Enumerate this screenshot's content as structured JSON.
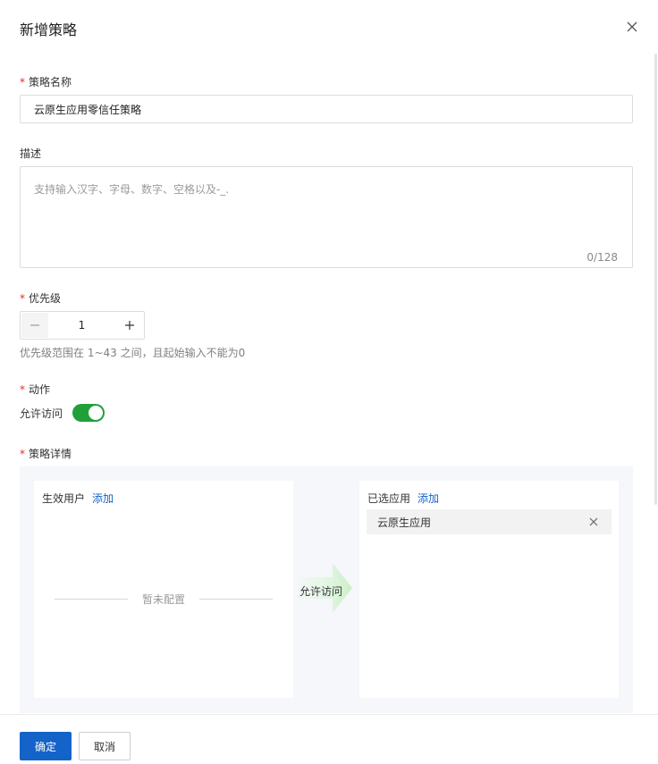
{
  "dialog": {
    "title": "新增策略"
  },
  "form": {
    "name": {
      "label": "策略名称",
      "value": "云原生应用零信任策略"
    },
    "description": {
      "label": "描述",
      "placeholder": "支持输入汉字、字母、数字、空格以及-_.",
      "count": "0/128"
    },
    "priority": {
      "label": "优先级",
      "value": "1",
      "help": "优先级范围在 1~43 之间，且起始输入不能为0"
    },
    "action": {
      "label": "动作",
      "toggle_label": "允许访问",
      "enabled": true,
      "toggle_color": "#21a03a"
    },
    "detail": {
      "label": "策略详情",
      "users_title": "生效用户",
      "users_add": "添加",
      "users_empty": "暂未配置",
      "arrow_label": "允许访问",
      "apps_title": "已选应用",
      "apps_add": "添加",
      "apps_selected": [
        "云原生应用"
      ]
    }
  },
  "footer": {
    "confirm": "确定",
    "cancel": "取消"
  },
  "colors": {
    "primary": "#1463c8",
    "required": "#e0301e"
  }
}
